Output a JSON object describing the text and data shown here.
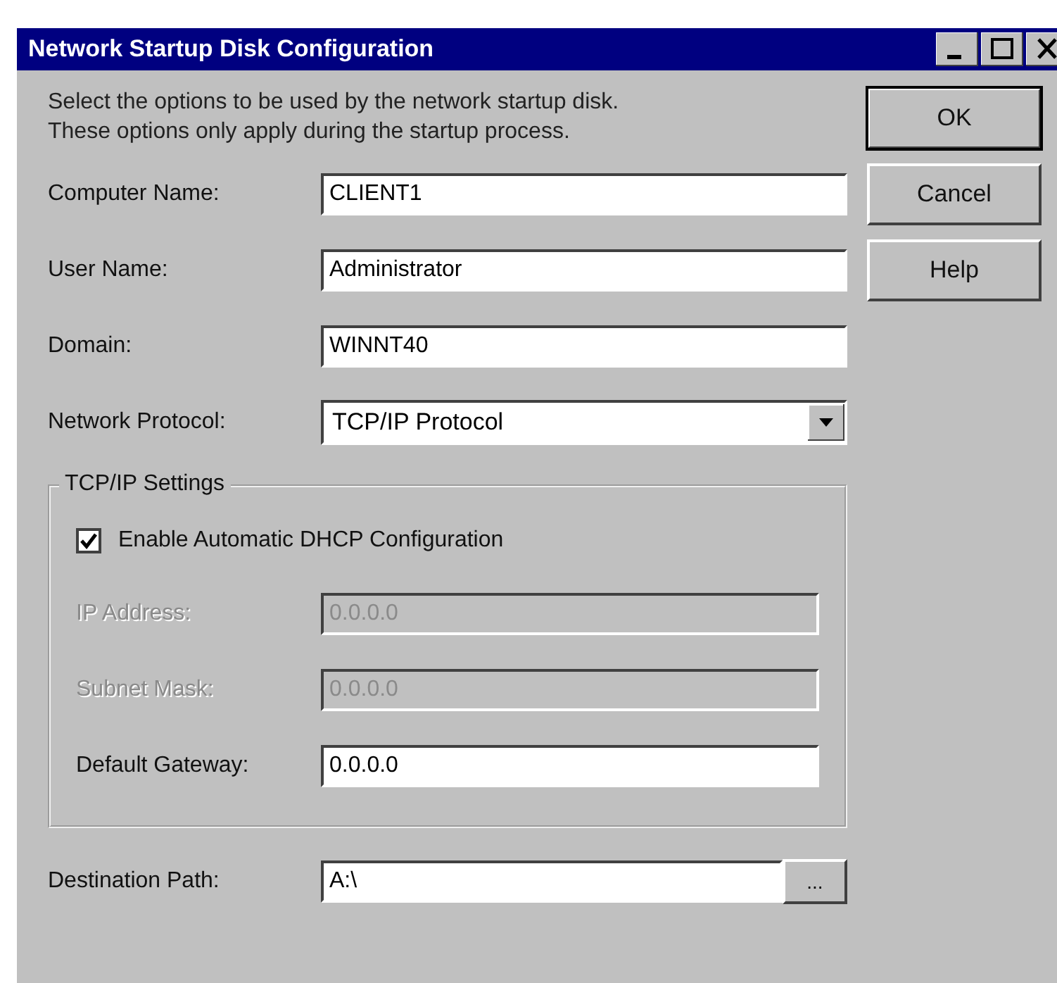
{
  "window": {
    "title": "Network Startup Disk Configuration"
  },
  "description": [
    "Select the options to be used by the network startup disk.",
    "These options only apply during the startup process."
  ],
  "fields": [
    {
      "label": "Computer Name:",
      "value": "CLIENT1",
      "kind": "text"
    },
    {
      "label": "User Name:",
      "value": "Administrator",
      "kind": "text"
    },
    {
      "label": "Domain:",
      "value": "WINNT40",
      "kind": "text"
    },
    {
      "label": "Network Protocol:",
      "value": "TCP/IP Protocol",
      "kind": "dropdown"
    }
  ],
  "tcpip": {
    "title": "TCP/IP Settings",
    "dhcp": {
      "label": "Enable Automatic DHCP Configuration",
      "checked": true
    },
    "fields": [
      {
        "label": "IP Address:",
        "value": "0.0.0.0",
        "disabled": true
      },
      {
        "label": "Subnet Mask:",
        "value": "0.0.0.0",
        "disabled": true
      },
      {
        "label": "Default Gateway:",
        "value": "0.0.0.0",
        "disabled": false
      }
    ]
  },
  "destination": {
    "label": "Destination Path:",
    "value": "A:\\",
    "browse": "..."
  },
  "buttons": [
    {
      "label": "OK",
      "default": true
    },
    {
      "label": "Cancel",
      "default": false
    },
    {
      "label": "Help",
      "default": false
    }
  ]
}
